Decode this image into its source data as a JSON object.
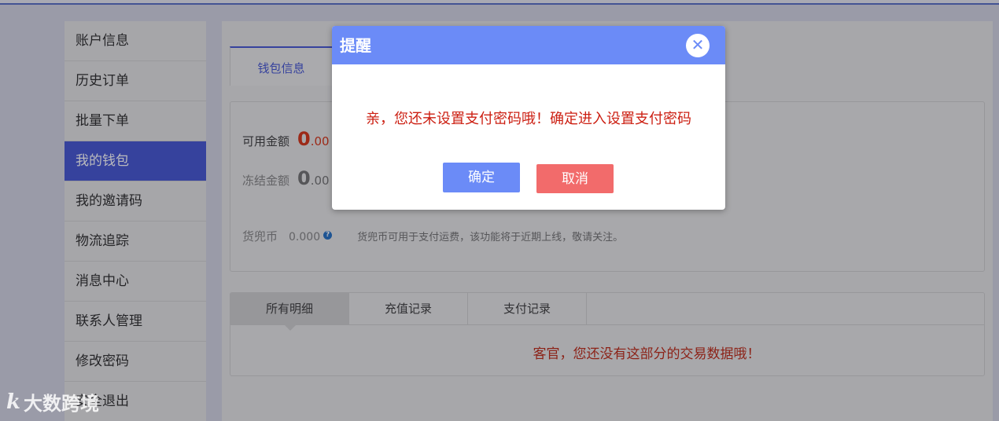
{
  "sidebar": {
    "items": [
      {
        "label": "账户信息"
      },
      {
        "label": "历史订单"
      },
      {
        "label": "批量下单"
      },
      {
        "label": "我的钱包"
      },
      {
        "label": "我的邀请码"
      },
      {
        "label": "物流追踪"
      },
      {
        "label": "消息中心"
      },
      {
        "label": "联系人管理"
      },
      {
        "label": "修改密码"
      },
      {
        "label": "安全退出"
      }
    ],
    "active_index": 3
  },
  "main": {
    "tab_label": "钱包信息",
    "available": {
      "label": "可用金额",
      "int": "0",
      "dec": ".00"
    },
    "frozen": {
      "label": "冻结金额",
      "int": "0",
      "dec": ".00"
    },
    "coin": {
      "label": "货兜币",
      "value": "0.000",
      "help": "?",
      "note": "货兜币可用于支付运费，该功能将于近期上线，敬请关注。"
    },
    "record_tabs": [
      "所有明细",
      "充值记录",
      "支付记录"
    ],
    "empty_message": "客官，您还没有这部分的交易数据哦！"
  },
  "dialog": {
    "title": "提醒",
    "close_symbol": "✕",
    "message": "亲，您还未设置支付密码哦！确定进入设置支付密码",
    "ok_label": "确定",
    "cancel_label": "取消"
  },
  "watermark": {
    "logo": "k",
    "text": "大数跨境"
  }
}
